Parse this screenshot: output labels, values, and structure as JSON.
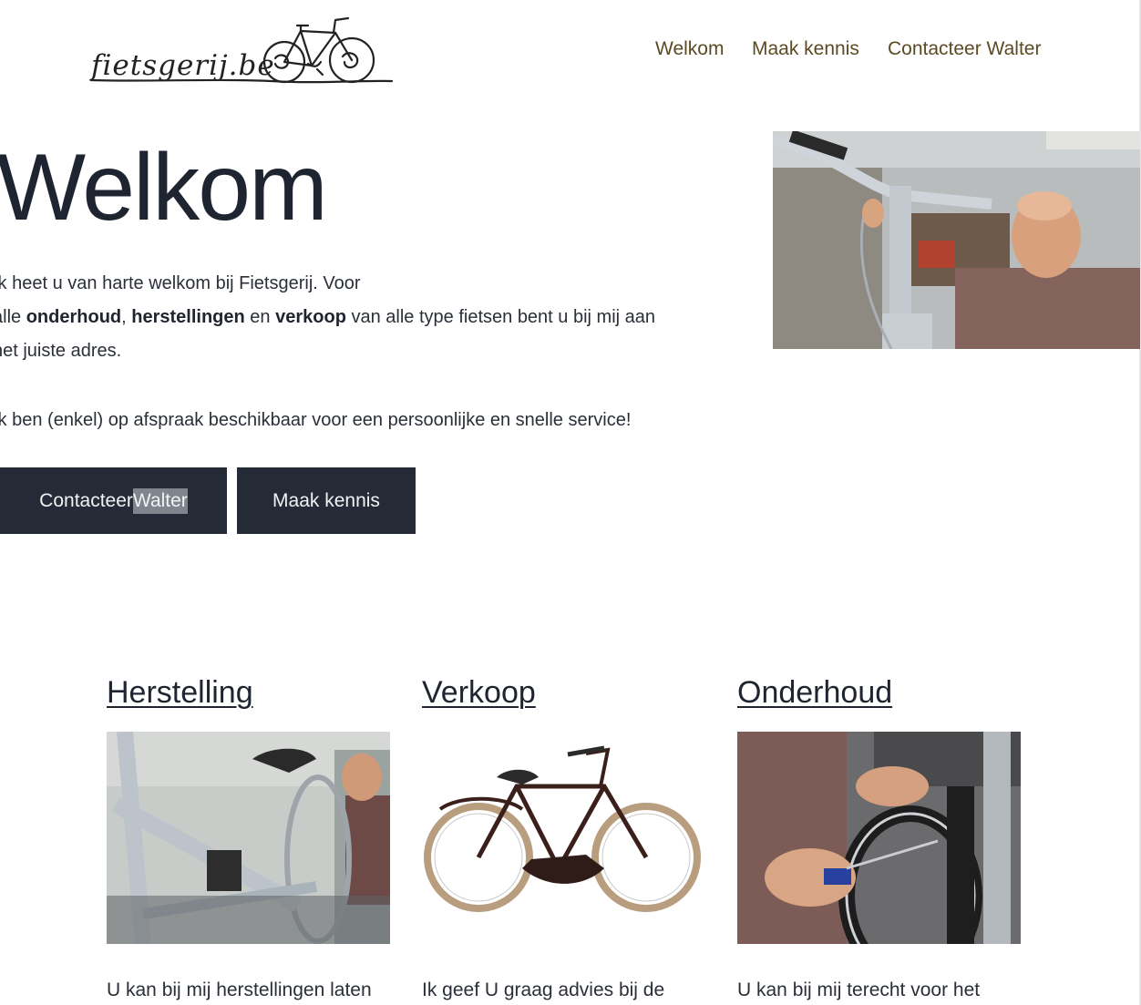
{
  "header": {
    "logo_text": "fietsgerij.be",
    "nav": [
      {
        "label": "Welkom"
      },
      {
        "label": "Maak kennis"
      },
      {
        "label": "Contacteer Walter"
      }
    ]
  },
  "hero": {
    "title": "Welkom",
    "intro_line1": "Ik heet u van harte welkom bij Fietsgerij. Voor",
    "intro_line2": {
      "prefix": "alle ",
      "bold1": "onderhoud",
      "sep1": ", ",
      "bold2": "herstellingen",
      "sep2": " en ",
      "bold3": "verkoop",
      "suffix": " van alle type fietsen bent u bij mij aan"
    },
    "intro_line3": "het juiste adres.",
    "note": "Ik ben (enkel) op afspraak beschikbaar voor een persoonlijke en snelle service!",
    "buttons": {
      "contact_prefix": "Contacteer ",
      "contact_highlight": "Walter",
      "meet": "Maak kennis"
    }
  },
  "services": [
    {
      "title": "Herstelling",
      "text": "U kan bij mij herstellingen laten"
    },
    {
      "title": "Verkoop",
      "text": "Ik geef U graag advies bij de"
    },
    {
      "title": "Onderhoud",
      "text": "U kan bij mij terecht voor het"
    }
  ]
}
